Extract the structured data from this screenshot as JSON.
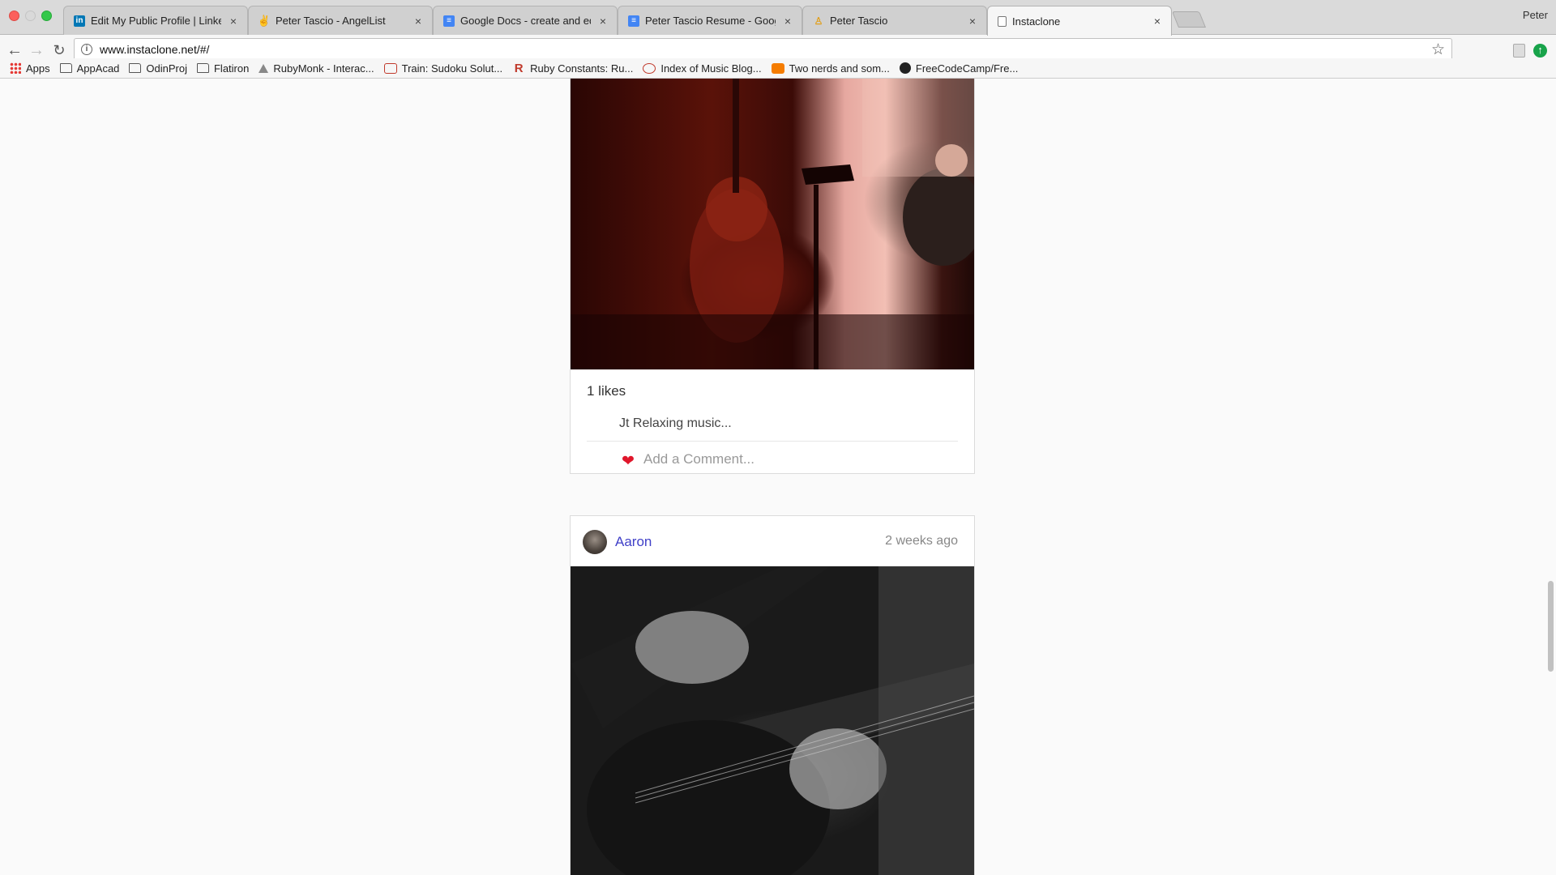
{
  "browser": {
    "tabs": [
      {
        "title": "Edit My Public Profile | LinkedIn",
        "icon": "linkedin-icon",
        "color": "#0077b5"
      },
      {
        "title": "Peter Tascio - AngelList",
        "icon": "angellist-icon",
        "color": "#555555"
      },
      {
        "title": "Google Docs - create and edit",
        "icon": "google-docs-icon",
        "color": "#4285f4"
      },
      {
        "title": "Peter Tascio Resume - Google",
        "icon": "google-docs-icon",
        "color": "#4285f4"
      },
      {
        "title": "Peter Tascio",
        "icon": "page-icon",
        "color": "#e0a020"
      },
      {
        "title": "Instaclone",
        "icon": "page-icon",
        "color": "#888888"
      }
    ],
    "active_tab": 5,
    "profile_name": "Peter",
    "url": "www.instaclone.net/#/"
  },
  "bookmarks": [
    {
      "label": "Apps",
      "icon": "apps-grid-icon"
    },
    {
      "label": "AppAcad",
      "icon": "folder-icon"
    },
    {
      "label": "OdinProj",
      "icon": "folder-icon"
    },
    {
      "label": "Flatiron",
      "icon": "folder-icon"
    },
    {
      "label": "RubyMonk - Interac...",
      "icon": "rubymonk-icon"
    },
    {
      "label": "Train: Sudoku Solut...",
      "icon": "sudoku-icon"
    },
    {
      "label": "Ruby Constants: Ru...",
      "icon": "ruby-r-icon"
    },
    {
      "label": "Index of Music Blog...",
      "icon": "music-blog-icon"
    },
    {
      "label": "Two nerds and som...",
      "icon": "blogger-icon"
    },
    {
      "label": "FreeCodeCamp/Fre...",
      "icon": "github-icon"
    }
  ],
  "feed": {
    "post1": {
      "likes": "1 likes",
      "caption": "Jt Relaxing music...",
      "comment_placeholder": "Add a Comment..."
    },
    "post2": {
      "username": "Aaron",
      "time_ago": "2 weeks ago"
    }
  },
  "colors": {
    "link": "#4040c8",
    "heart": "#e0162b"
  }
}
